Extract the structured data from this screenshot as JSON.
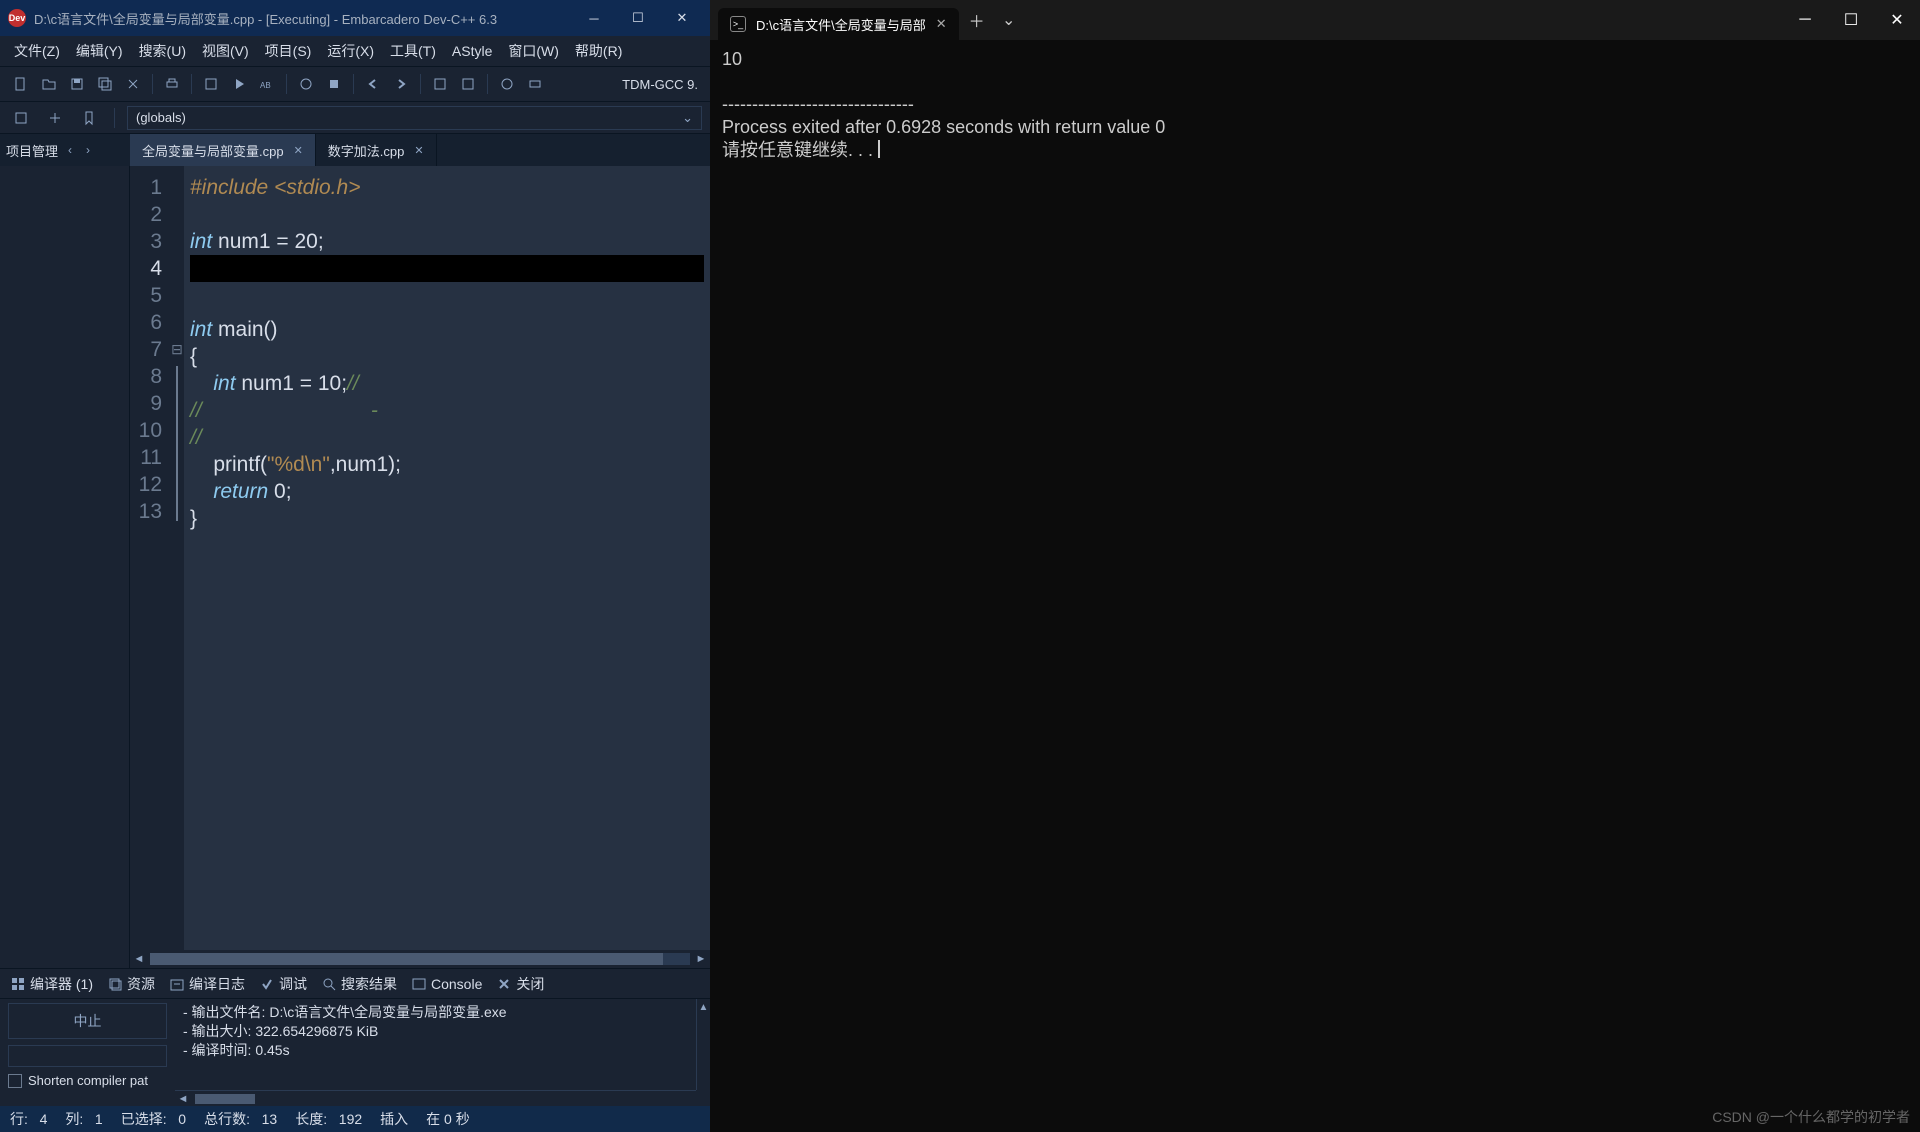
{
  "ide": {
    "title": "D:\\c语言文件\\全局变量与局部变量.cpp - [Executing] - Embarcadero Dev-C++ 6.3",
    "logo_text": "Dev",
    "menus": [
      "文件(Z)",
      "编辑(Y)",
      "搜索(U)",
      "视图(V)",
      "项目(S)",
      "运行(X)",
      "工具(T)",
      "AStyle",
      "窗口(W)",
      "帮助(R)"
    ],
    "compiler_name": "TDM-GCC 9.",
    "globals_label": "(globals)",
    "sidebar_tab": "项目管理",
    "tabs": [
      {
        "name": "全局变量与局部变量.cpp",
        "active": true
      },
      {
        "name": "数字加法.cpp",
        "active": false
      }
    ],
    "code": {
      "lines": [
        "1",
        "2",
        "3",
        "4",
        "5",
        "6",
        "7",
        "8",
        "9",
        "10",
        "11",
        "12",
        "13"
      ],
      "current_line": "4",
      "l1_inc": "#include ",
      "l1_hdr": "<stdio.h>",
      "l3_kw": "int",
      "l3_rest": " num1 = 20;",
      "l6_kw": "int",
      "l6_rest": " main()",
      "l7": "{",
      "l8_kw": "int",
      "l8_rest": " num1 = 10;",
      "l8_cm": "//",
      "l9_cm": "//",
      "l9_cm_tail": "                             -",
      "l10_cm": "//",
      "l11": "    printf(",
      "l11_str": "\"%d\\n\"",
      "l11_tail": ",num1);",
      "l12_kw": "return",
      "l12_rest": " 0;",
      "l13": "}"
    },
    "bottom_tabs": {
      "compiler": "编译器 (1)",
      "resource": "资源",
      "log": "编译日志",
      "debug": "调试",
      "search": "搜索结果",
      "console": "Console",
      "close": "关闭"
    },
    "log": {
      "abort": "中止",
      "shorten": "Shorten compiler pat",
      "line1": "- 输出文件名: D:\\c语言文件\\全局变量与局部变量.exe",
      "line2": "- 输出大小: 322.654296875 KiB",
      "line3": "- 编译时间: 0.45s"
    },
    "status": {
      "line_lbl": "行:",
      "line_val": "4",
      "col_lbl": "列:",
      "col_val": "1",
      "sel_lbl": "已选择:",
      "sel_val": "0",
      "total_lbl": "总行数:",
      "total_val": "13",
      "len_lbl": "长度:",
      "len_val": "192",
      "mode": "插入",
      "time": "在 0 秒"
    }
  },
  "terminal": {
    "tab_title": "D:\\c语言文件\\全局变量与局部",
    "output_val": "10",
    "sep": "--------------------------------",
    "exit_msg": "Process exited after 0.6928 seconds with return value 0",
    "prompt": "请按任意键继续. . . ",
    "watermark": "CSDN @一个什么都学的初学者"
  }
}
